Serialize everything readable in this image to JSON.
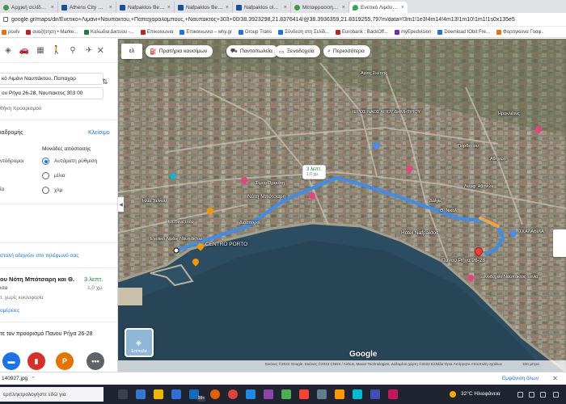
{
  "browser": {
    "tabs": [
      {
        "label": "Αρχική σελίδα σμάλ",
        "favicon": "fav-g",
        "active": false
      },
      {
        "label": "Athens City Center H",
        "favicon": "fav-b",
        "active": false
      },
      {
        "label": "Nafpaktos Beach Ho",
        "favicon": "fav-b",
        "active": false
      },
      {
        "label": "Nafpaktos Beach Ho",
        "favicon": "fav-b",
        "active": false
      },
      {
        "label": "Nafpaktos old town",
        "favicon": "fav-b",
        "active": false
      },
      {
        "label": "Μεταφρασση Google",
        "favicon": "fav-g",
        "active": false
      },
      {
        "label": "Ενετικό Λιμάνι Ναυ",
        "favicon": "fav-m",
        "active": true
      }
    ],
    "url": "google.gr/maps/dir/Ενετικό+Λιμάνι+Ναυπάκτου,+Παπαχαραλάμπους,+Ναύπακτος+303+00/38.3923298,21.8376414/@38.3936359,21.8319255,797m/data=!3m1!1e3!4m14!4m13!1m10!1m1!1s0x135e5",
    "bookmarks": [
      {
        "label": "ρουίν",
        "favicon": "fav-orange"
      },
      {
        "label": "αναζήτηση • Marke...",
        "favicon": "fav-red"
      },
      {
        "label": "Καλωδια Δικτυου -...",
        "favicon": "fav-green"
      },
      {
        "label": "Επικοινωνια",
        "favicon": "fav-red"
      },
      {
        "label": "Επικοινωνια – why.gr",
        "favicon": "fav-blue"
      },
      {
        "label": "Group Trans",
        "favicon": "fav-blue"
      },
      {
        "label": "Σύνδεση στη Σελίδ...",
        "favicon": "fav-blue"
      },
      {
        "label": "Eurobank : BackOff...",
        "favicon": "fav-red"
      },
      {
        "label": "myEpedvision",
        "favicon": "fav-purple"
      },
      {
        "label": "Download IObit Fre...",
        "favicon": "fav-blue"
      },
      {
        "label": "Φορτιγκεινα Γοαφ..",
        "favicon": "fav-orange"
      }
    ]
  },
  "directions": {
    "origin": "κό Λιμάνι Ναυπάκτου, Παπαχαρ",
    "destination": "ου Ρήγα 26-28, Ναυπακτος 303 00",
    "add_destination": "θήκη προορισμού",
    "options_title": "ιαδρομής",
    "options_close": "Κλείσιμο",
    "left_options": [
      "ντόδρομοι",
      "ία"
    ],
    "units_title": "Μονάδες απόστασης",
    "units": [
      {
        "label": "Αυτόματη ρύθμιση",
        "selected": true
      },
      {
        "label": "μίλια",
        "selected": false
      },
      {
        "label": "χλμ",
        "selected": false
      }
    ],
    "send_to_phone": "στολή οδηγιών στο τηλέφωνό σας",
    "route": {
      "name": "ου Νότη Μπότσαρη και Θ.",
      "name2": "ισα",
      "time": "3 λεπτ.",
      "distance": "1,0 χμ.",
      "traffic": "τ. χωρίς κυκλοφορία",
      "details": "ομέρειες"
    },
    "nearby_title": "τε τον προορισμό Πανου Ρήγα 26-28",
    "categories": [
      {
        "label": "ενοδοχεία",
        "icon": "hotel-icon",
        "color": "#1a73e8",
        "glyph": "▬"
      },
      {
        "label": "Βενζινάδικα",
        "icon": "fuel-icon",
        "color": "#d93025",
        "glyph": "▮"
      },
      {
        "label": "Χώροι στάθμευσης",
        "icon": "parking-icon",
        "color": "#e37400",
        "glyph": "P"
      },
      {
        "label": "Περισσότερα",
        "icon": "more-icon",
        "color": "#5f6368",
        "glyph": "•••"
      }
    ]
  },
  "map": {
    "lang_button": "ελ",
    "chips": [
      {
        "label": "Πρατήρια καυσίμων",
        "icon": "fuel-icon",
        "glyph": "⛽"
      },
      {
        "label": "Παντοπωλεία",
        "icon": "cart-icon",
        "glyph": "⛟"
      },
      {
        "label": "Ξενοδοχεία",
        "icon": "bed-icon",
        "glyph": "▭"
      },
      {
        "label": "Περισσότερα",
        "icon": "search-icon",
        "glyph": "⌕"
      }
    ],
    "route_bubble_time": "3 λεπτ.",
    "route_bubble_dist": "1,0 χμ.",
    "layers_label": "Επίπεδα",
    "labels": [
      {
        "text": "Νότη Μπότσαρη",
        "x": 0,
        "y": 0
      },
      {
        "text": "Hotel Nafpaktos",
        "x": 0,
        "y": 0
      }
    ],
    "street_labels": [
      "Αγίας Σκέπης",
      "Ηρακλέους",
      "Νότη Μπότσαρη",
      "Αθηνών",
      "Σίμου Πρεκάτη",
      "Δαίγες",
      "Θ. Νικολ",
      "Ελ.Βενιζέλου",
      "Ηλία Τάλκου",
      "Λεωφ. Αθηνών",
      "Διασποροί",
      "Παρθενίου"
    ],
    "poi_labels": [
      "ΙΕΡΟΣ ΝΑΟΣ ΑΓΙΟΥ ΔΗΜΗΤΡΙΟΥ",
      "Hotel Nafpaktos",
      "CENTRO PORTO",
      "Ενετικό Λιμάνι Ναυπάκτου",
      "Πανου Ρήγα 26-28",
      "ΣΚΑΛΑΒΙΛΑ",
      "Ξενοδοχείο Ναύπακτος Ξενία"
    ],
    "google": "Google",
    "footer": "Εικόνες ©2022 Google, Εικόνες ©2022 CNES / Airbus, Maxar Technologies, Δεδομένα χάρτη ©2022   Ελλάδα   Όροι   Απόρρητο   Αποστολή σχολίων",
    "scale": "100 μέτρα"
  },
  "downloads": {
    "file": "140927.jpg",
    "show_all": "Εμφάνιση όλων"
  },
  "taskbar": {
    "search_placeholder": "ερπληκτρολογήστε εδώ για",
    "badge": "99+",
    "weather": "32°C  Ηλιοφάνεια"
  }
}
